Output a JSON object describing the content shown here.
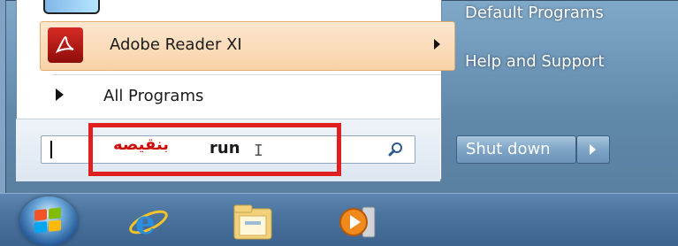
{
  "start_menu": {
    "pinned_items": [
      {
        "label": "Adobe Reader XI",
        "icon": "adobe-reader-icon",
        "has_submenu": true
      }
    ],
    "all_programs_label": "All Programs",
    "search": {
      "value": "run",
      "annotation": "بنقيصه"
    },
    "right_column": {
      "items": [
        "Default Programs",
        "Help and Support"
      ]
    },
    "shutdown": {
      "label": "Shut down"
    }
  },
  "taskbar": {
    "icons": [
      "start-orb-icon",
      "internet-explorer-icon",
      "windows-explorer-icon",
      "media-player-icon"
    ]
  },
  "colors": {
    "highlight_box": "#e02020",
    "annotation_text": "#cc1010",
    "adobe_red": "#c41e1a"
  }
}
